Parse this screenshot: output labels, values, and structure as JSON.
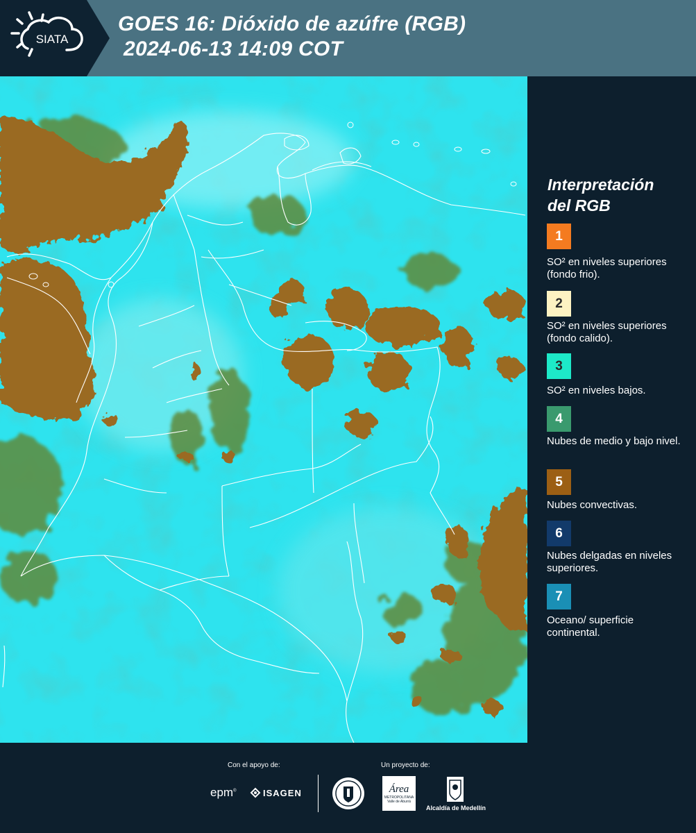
{
  "header": {
    "logo_text": "SIATA",
    "title_line1": "GOES 16: Dióxido de azúfre (RGB)",
    "title_line2": "2024-06-13 14:09 COT"
  },
  "legend": {
    "heading_line1": "Interpretación",
    "heading_line2": "del RGB",
    "items": [
      {
        "num": "1",
        "color": "#f47b20",
        "text": "SO² en niveles superiores (fondo frio)."
      },
      {
        "num": "2",
        "color": "#fdf2c2",
        "text": "SO² en niveles superiores (fondo calido)."
      },
      {
        "num": "3",
        "color": "#1de9c8",
        "text": "SO² en niveles bajos."
      },
      {
        "num": "4",
        "color": "#3a9a6e",
        "text": "Nubes de medio y bajo nivel."
      },
      {
        "num": "5",
        "color": "#9c5f14",
        "text": "Nubes convectivas."
      },
      {
        "num": "6",
        "color": "#123a6a",
        "text": "Nubes delgadas en niveles superiores."
      },
      {
        "num": "7",
        "color": "#1a8fb5",
        "text": "Oceano/ superficie continental."
      }
    ]
  },
  "footer": {
    "support_label": "Con el apoyo de:",
    "project_label": "Un proyecto de:",
    "epm_text": "epm",
    "isagen_text": "ISAGEN",
    "area_text": "Área",
    "area_subtext": "METROPOLITANA",
    "area_subtext2": "Valle de Aburrá",
    "alcaldia_text": "Alcaldía de Medellín"
  },
  "colors": {
    "header_bg": "#4a7282",
    "panel_bg": "#0d1f2d",
    "clear_sky": "#2ee3ee",
    "convective": "#9a6a22",
    "mid_level": "#5f8a3a"
  }
}
